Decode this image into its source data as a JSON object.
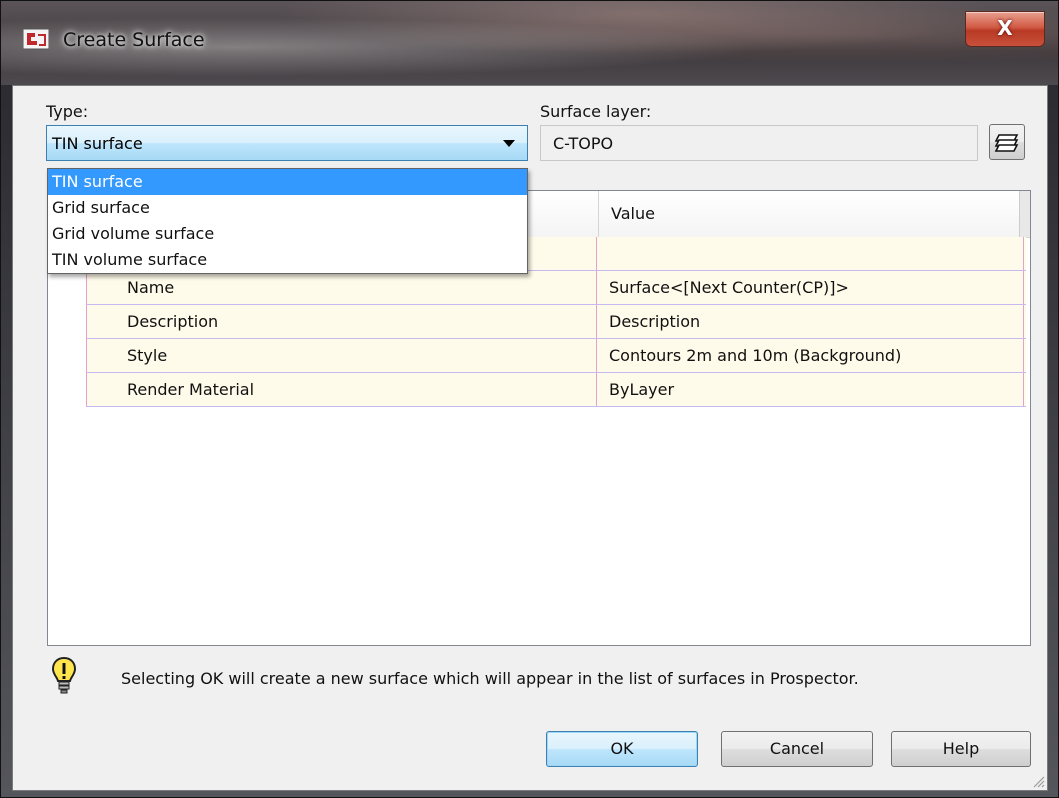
{
  "window": {
    "title": "Create Surface",
    "close_label": "X"
  },
  "type_field": {
    "label": "Type:",
    "selected": "TIN surface",
    "options": [
      "TIN surface",
      "Grid surface",
      "Grid volume surface",
      "TIN volume surface"
    ]
  },
  "layer_field": {
    "label": "Surface layer:",
    "value": "C-TOPO"
  },
  "grid": {
    "value_header": "Value",
    "rows": [
      {
        "property": "Name",
        "value": "Surface<[Next Counter(CP)]>"
      },
      {
        "property": "Description",
        "value": "Description"
      },
      {
        "property": "Style",
        "value": "Contours 2m and 10m (Background)"
      },
      {
        "property": "Render Material",
        "value": "ByLayer"
      }
    ]
  },
  "info": {
    "text": "Selecting OK will create a new surface which will appear in the list of surfaces in Prospector."
  },
  "buttons": {
    "ok": "OK",
    "cancel": "Cancel",
    "help": "Help"
  },
  "colors": {
    "selection": "#3399ff",
    "row_background": "#fffbea",
    "close_button": "#c8503a"
  }
}
